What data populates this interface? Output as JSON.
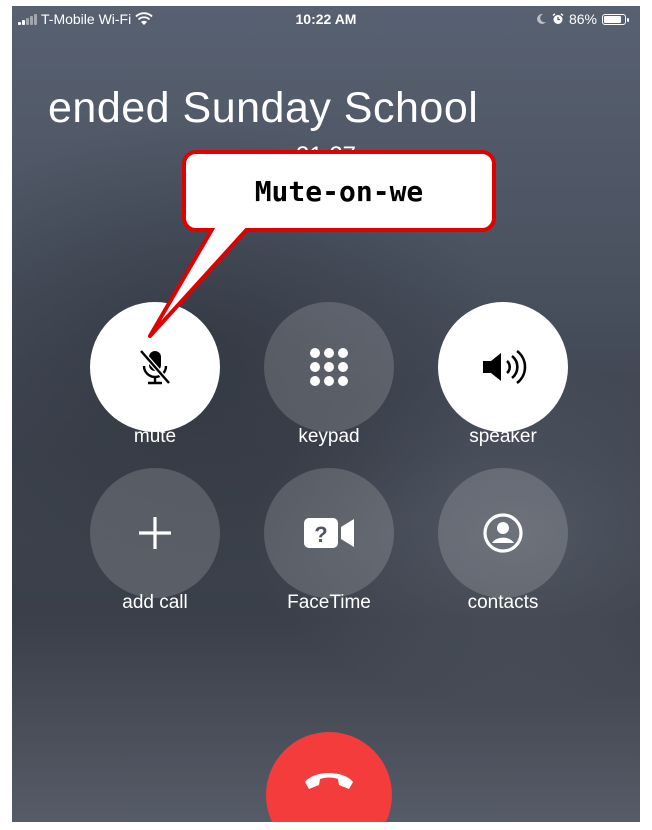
{
  "status_bar": {
    "carrier": "T-Mobile Wi-Fi",
    "time": "10:22 AM",
    "battery_percent": "86%",
    "battery_level": 0.86,
    "icons": [
      "signal-icon",
      "wifi-icon",
      "moon-icon",
      "alarm-icon",
      "battery-icon"
    ]
  },
  "call": {
    "caller_name": "ended     Sunday School",
    "timer": "31:27"
  },
  "controls": {
    "mute": {
      "label": "mute",
      "icon": "mic-slash-icon",
      "active": true
    },
    "keypad": {
      "label": "keypad",
      "icon": "keypad-icon",
      "active": false
    },
    "speaker": {
      "label": "speaker",
      "icon": "speaker-icon",
      "active": true
    },
    "add_call": {
      "label": "add call",
      "icon": "plus-icon",
      "active": false
    },
    "facetime": {
      "label": "FaceTime",
      "icon": "facetime-icon",
      "active": false
    },
    "contacts": {
      "label": "contacts",
      "icon": "contacts-icon",
      "active": false
    }
  },
  "end_call": {
    "icon": "phone-hangup-icon",
    "color": "#f43c3c"
  },
  "annotation": {
    "text": "Mute-on-we",
    "border_color": "#e00000"
  }
}
